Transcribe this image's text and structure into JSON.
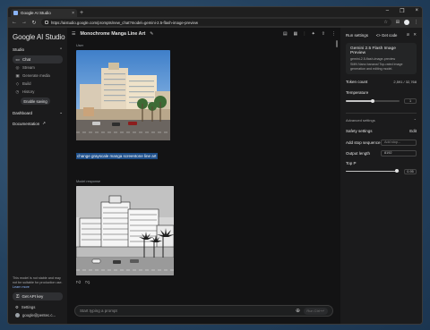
{
  "browser": {
    "tab_title": "Google AI Studio",
    "tab_close": "×",
    "new_tab": "+",
    "url": "https://aistudio.google.com/prompts/new_chat?model=gemini-2.5-flash-image-preview",
    "window_controls": [
      "–",
      "❐",
      "×"
    ]
  },
  "sidebar": {
    "logo": "Google AI Studio",
    "studio_label": "Studio",
    "items": [
      {
        "label": "Chat",
        "icon": "chat-icon"
      },
      {
        "label": "Stream",
        "icon": "stream-icon"
      },
      {
        "label": "Generate media",
        "icon": "media-icon"
      },
      {
        "label": "Build",
        "icon": "build-icon"
      },
      {
        "label": "History",
        "icon": "history-icon"
      }
    ],
    "autosave_label": "Enable saving",
    "dashboard_label": "Dashboard",
    "documentation_label": "Documentation",
    "note_text": "This model is not stable and may not be suitable for production use.",
    "learn_more": "Learn more",
    "api_key_label": "Get API key",
    "settings_label": "Settings",
    "user_email": "google@pentec.c..."
  },
  "main": {
    "title": "Monochrome Manga Line Art",
    "user_label": "User",
    "user_prompt": "change grayscale manga screentone line art",
    "model_label": "Model response",
    "input_placeholder": "Start typing a prompt",
    "run_label": "Run  Ctrl+↵"
  },
  "run_settings": {
    "title": "Run settings",
    "get_code": "<> Get code",
    "model": {
      "name": "Gemini 2.5 Flash Image Preview",
      "id": "gemini-2.5-flash-image-preview",
      "description": "SMN Nano banana! Top-rated image generation and editing model."
    },
    "token_count_label": "Token count",
    "token_count_value": "2,591 / 32,768",
    "temperature_label": "Temperature",
    "temperature_value": "1",
    "temperature_fraction": 0.5,
    "advanced_label": "Advanced settings",
    "safety_label": "Safety settings",
    "safety_edit": "Edit",
    "stop_label": "Add stop sequence",
    "stop_placeholder": "Add stop...",
    "output_length_label": "Output length",
    "output_length_value": "8192",
    "top_p_label": "Top P",
    "top_p_value": "0.95",
    "top_p_fraction": 0.95
  },
  "colors": {
    "selection": "#1d4e89",
    "panel": "#1b1b1c",
    "canvas": "#131314"
  }
}
